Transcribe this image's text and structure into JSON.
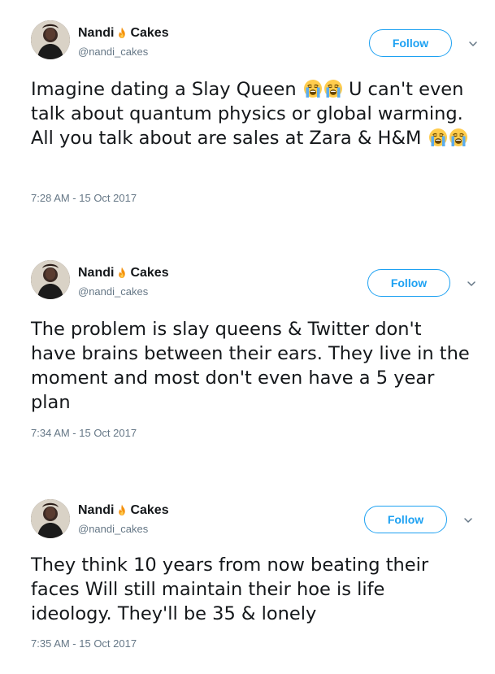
{
  "tweets": [
    {
      "name_first": "Nandi",
      "name_second": "Cakes",
      "name_emoji": "fire-icon",
      "handle": "@nandi_cakes",
      "follow_label": "Follow",
      "text_parts": {
        "p1": "Imagine dating a Slay Queen",
        "p2": "U can't even talk about quantum physics or global warming. All you talk about are sales at Zara & H&M"
      },
      "text_emoji": "loudly-crying-face-icon",
      "timestamp": "7:28 AM - 15 Oct 2017"
    },
    {
      "name_first": "Nandi",
      "name_second": "Cakes",
      "name_emoji": "fire-icon",
      "handle": "@nandi_cakes",
      "follow_label": "Follow",
      "text": "The problem is slay queens & Twitter don't have brains between their ears. They live in the moment and most don't even have a 5 year plan",
      "timestamp": "7:34 AM - 15 Oct 2017"
    },
    {
      "name_first": "Nandi",
      "name_second": "Cakes",
      "name_emoji": "fire-icon",
      "handle": "@nandi_cakes",
      "follow_label": "Follow",
      "text": "They think 10 years from now beating their faces Will still maintain their hoe is life ideology. They'll be 35 & lonely",
      "timestamp": "7:35 AM - 15 Oct 2017"
    }
  ],
  "colors": {
    "accent": "#1da1f2",
    "text": "#14171a",
    "muted": "#657786",
    "background": "#ffffff"
  }
}
